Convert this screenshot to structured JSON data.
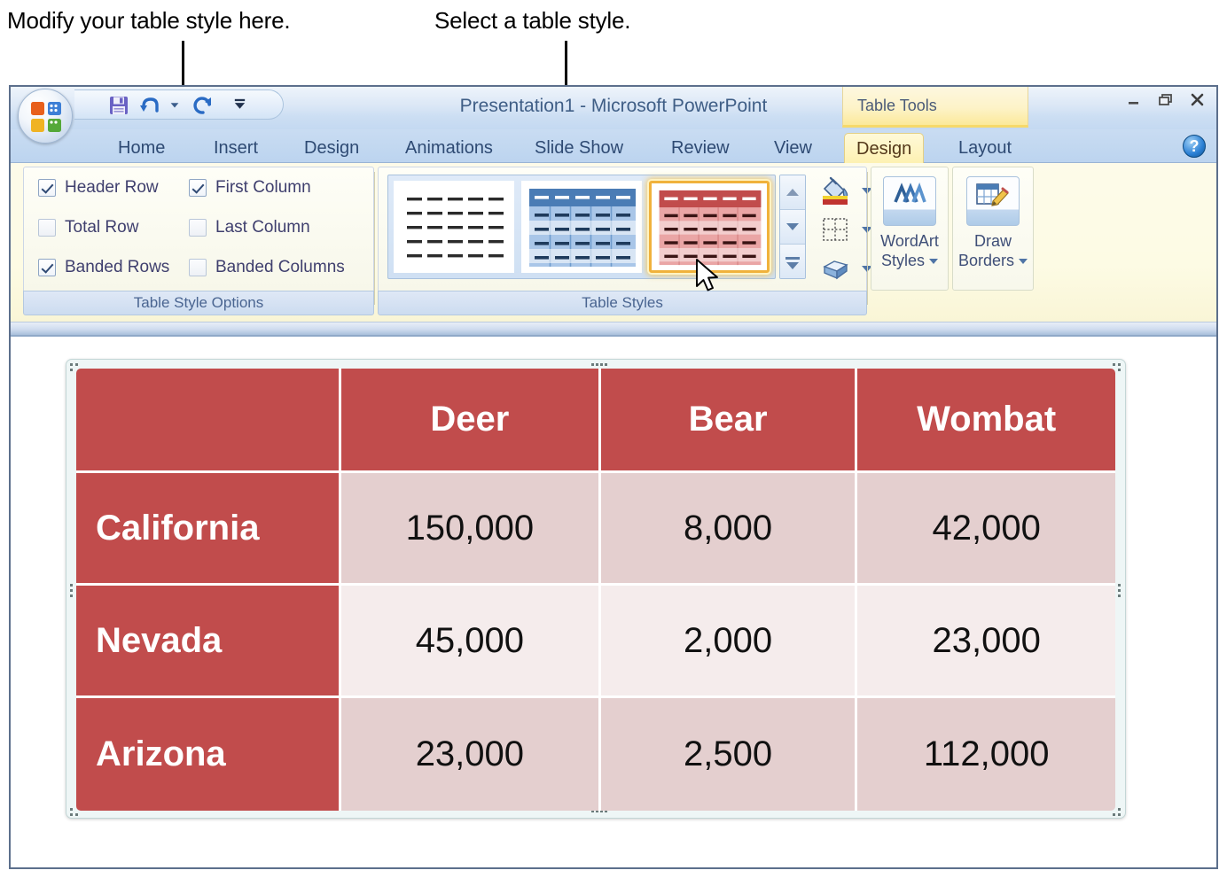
{
  "annotations": [
    {
      "text": "Modify your table style here."
    },
    {
      "text": "Select a table style."
    }
  ],
  "window": {
    "title": "Presentation1 - Microsoft PowerPoint",
    "contextual_tab_group": "Table Tools",
    "office_button": "office-orb",
    "quick_access": [
      {
        "name": "save",
        "glyph": "💾"
      },
      {
        "name": "undo",
        "glyph": "↶"
      },
      {
        "name": "undo-dropdown",
        "glyph": "▾"
      },
      {
        "name": "redo",
        "glyph": "↻"
      },
      {
        "name": "customize-qat",
        "glyph": "▾"
      }
    ],
    "controls": [
      {
        "name": "minimize",
        "glyph": "–"
      },
      {
        "name": "restore",
        "glyph": "❐"
      },
      {
        "name": "close",
        "glyph": "✕"
      }
    ],
    "help_label": "?"
  },
  "tabs": [
    {
      "label": "Home",
      "active": false
    },
    {
      "label": "Insert",
      "active": false
    },
    {
      "label": "Design",
      "active": false
    },
    {
      "label": "Animations",
      "active": false
    },
    {
      "label": "Slide Show",
      "active": false
    },
    {
      "label": "Review",
      "active": false
    },
    {
      "label": "View",
      "active": false
    },
    {
      "label": "Design",
      "active": true
    },
    {
      "label": "Layout",
      "active": false
    }
  ],
  "ribbon": {
    "table_style_options": {
      "group_label": "Table Style Options",
      "checkboxes": [
        {
          "label": "Header Row",
          "checked": true
        },
        {
          "label": "First Column",
          "checked": true
        },
        {
          "label": "Total Row",
          "checked": false
        },
        {
          "label": "Last Column",
          "checked": false
        },
        {
          "label": "Banded Rows",
          "checked": true
        },
        {
          "label": "Banded Columns",
          "checked": false
        }
      ]
    },
    "table_styles": {
      "group_label": "Table Styles",
      "thumbnails": [
        {
          "name": "no-style-table-grid",
          "accent": "#2b2b2b",
          "selected": false
        },
        {
          "name": "themed-style-blue",
          "accent": "#3d6fb0",
          "selected": false
        },
        {
          "name": "themed-style-red",
          "accent": "#c14c4c",
          "selected": true
        }
      ],
      "scroll_buttons": [
        {
          "name": "scroll-up"
        },
        {
          "name": "scroll-down"
        },
        {
          "name": "more-styles"
        }
      ],
      "commands": [
        {
          "name": "shading",
          "glyph": "shading-bucket-icon"
        },
        {
          "name": "borders",
          "glyph": "borders-grid-icon"
        },
        {
          "name": "effects",
          "glyph": "effects-cube-icon"
        }
      ]
    },
    "wordart_styles": {
      "line1": "WordArt",
      "line2": "Styles",
      "icon": "wordart-A-icon"
    },
    "draw_borders": {
      "line1": "Draw",
      "line2": "Borders",
      "icon": "pencil-table-icon"
    }
  },
  "slide": {
    "table": {
      "headers": [
        "",
        "Deer",
        "Bear",
        "Wombat"
      ],
      "rows": [
        {
          "label": "California",
          "values": [
            "150,000",
            "8,000",
            "42,000"
          ]
        },
        {
          "label": "Nevada",
          "values": [
            "45,000",
            "2,000",
            "23,000"
          ]
        },
        {
          "label": "Arizona",
          "values": [
            "23,000",
            "2,500",
            "112,000"
          ]
        }
      ]
    }
  },
  "colors": {
    "table_accent": "#c14c4c",
    "band_dark": "#e4cfcf",
    "band_light": "#f5ecec",
    "ribbon_bg": "#fdfbe4",
    "tab_active": "#fdf1b2",
    "titlebar": "#ccdef3"
  }
}
